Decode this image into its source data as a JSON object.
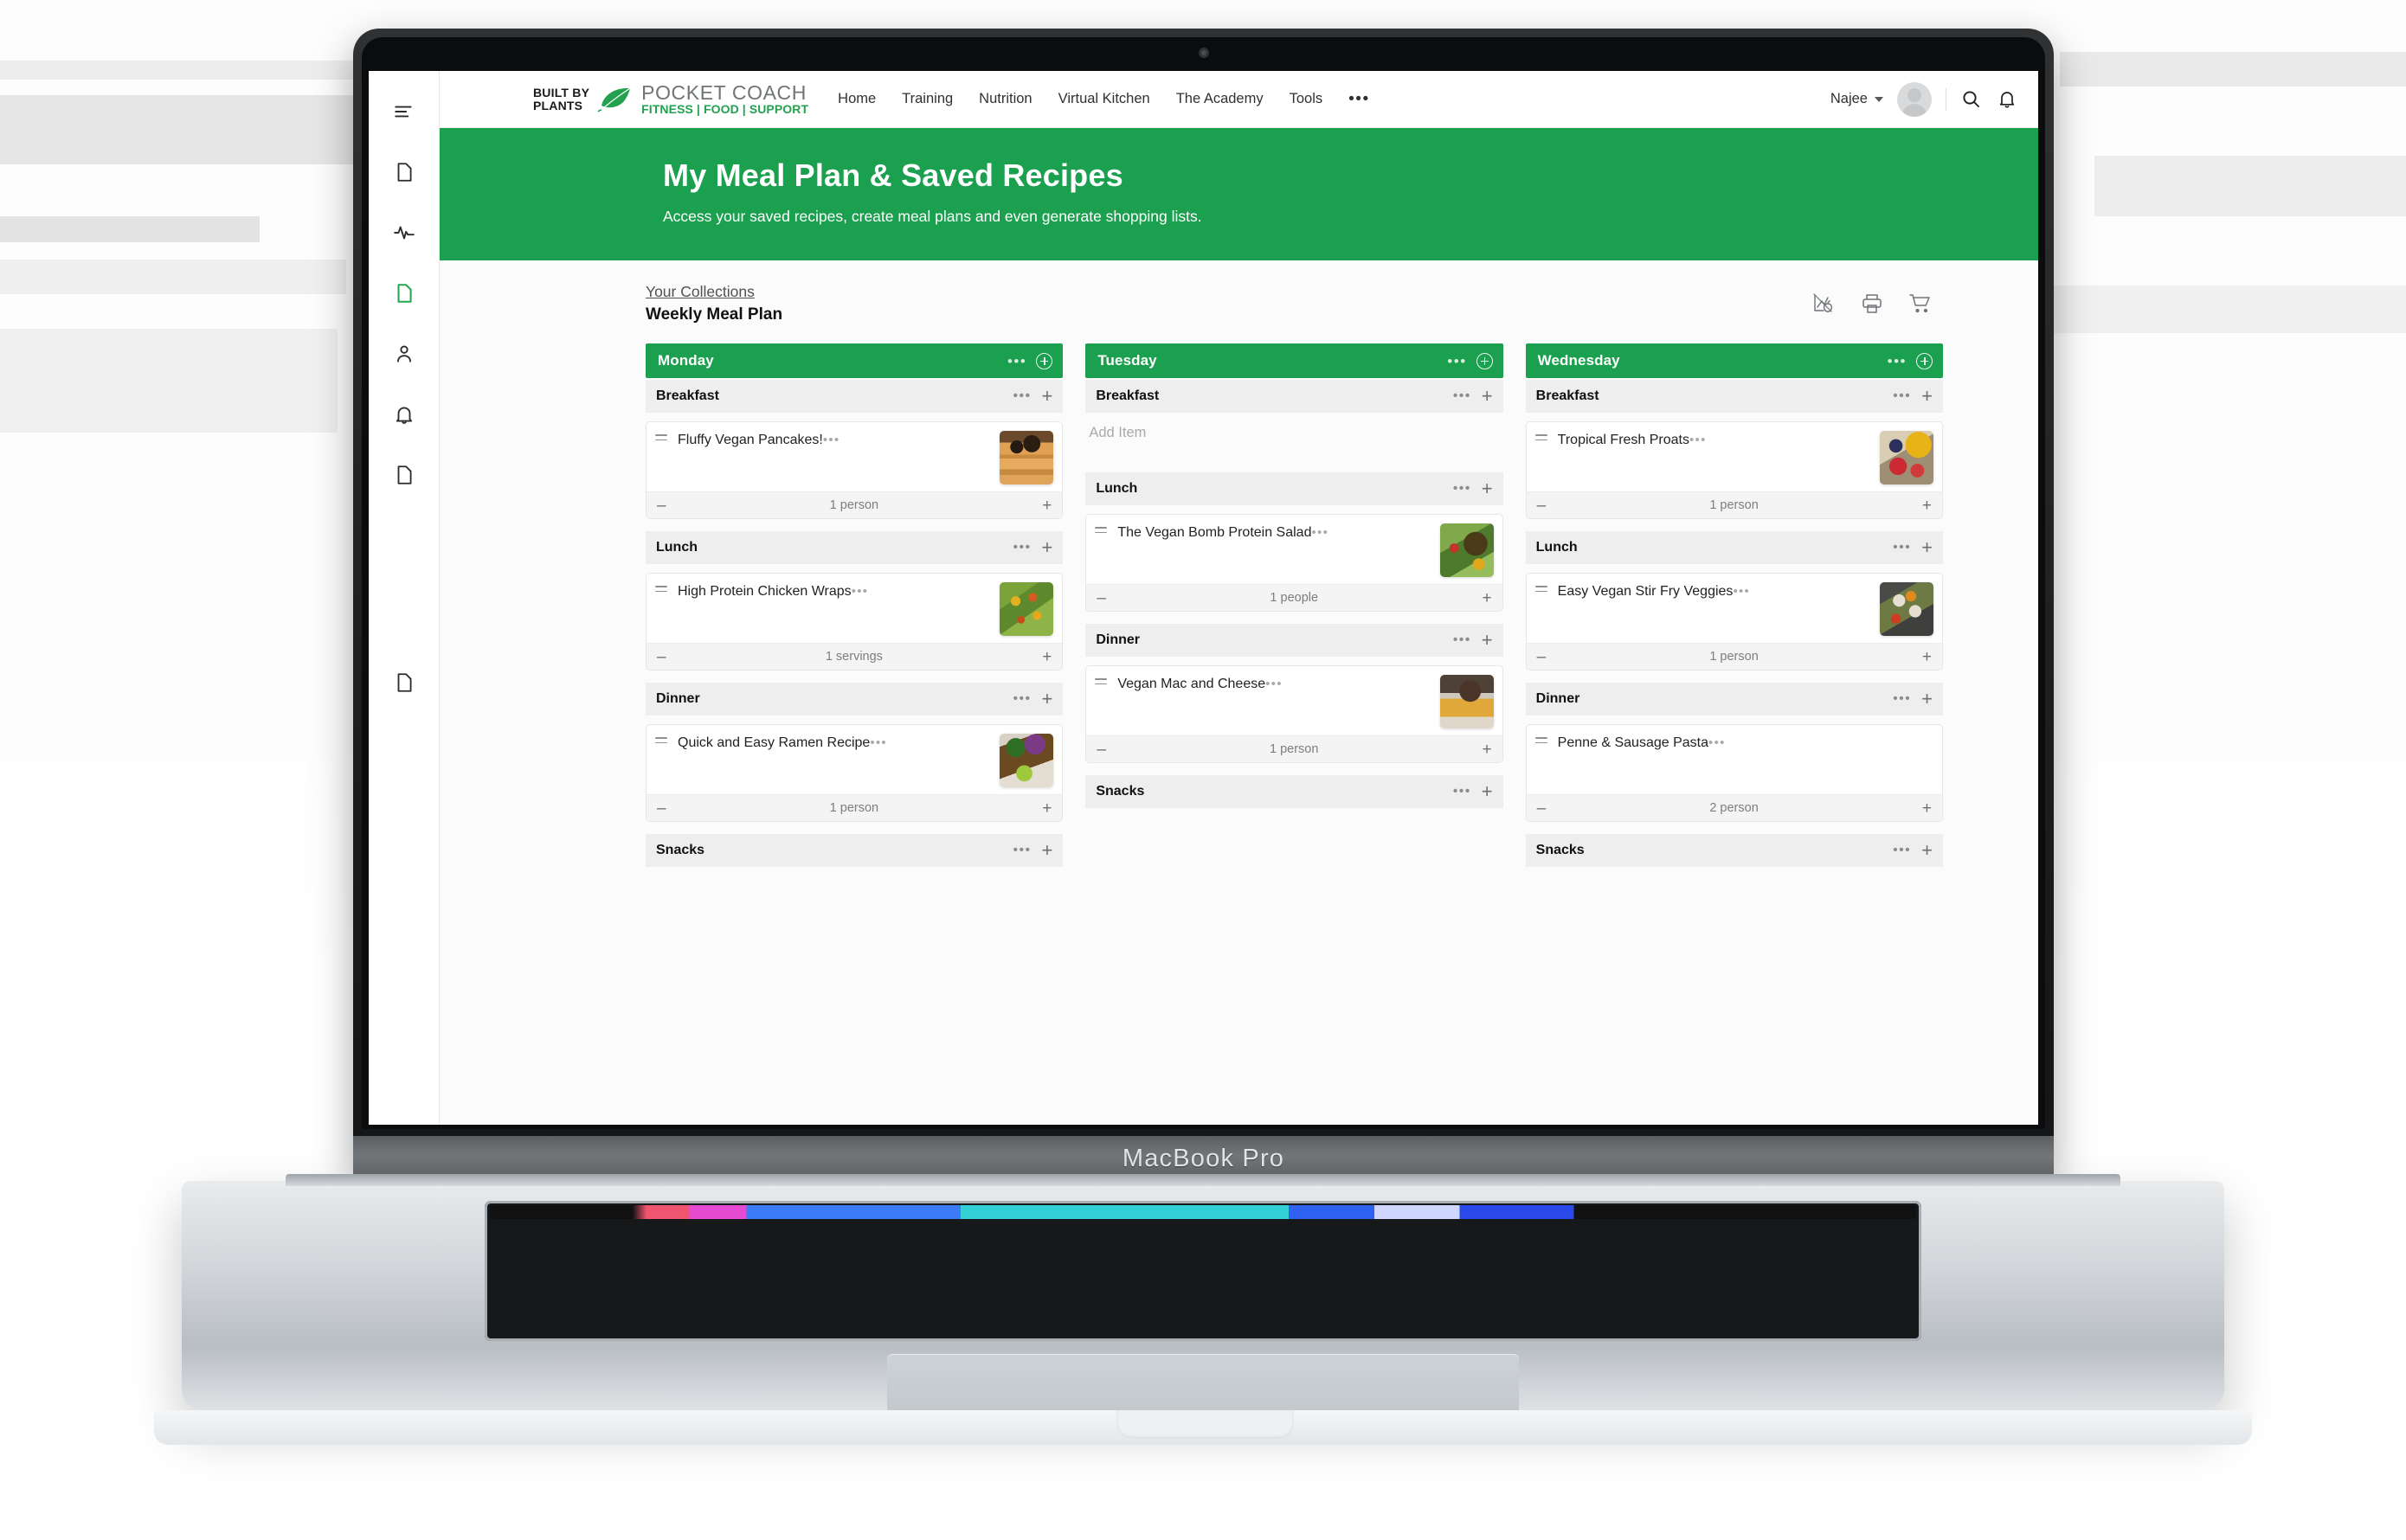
{
  "device": {
    "model_label": "MacBook Pro"
  },
  "brand": {
    "built_by": "BUILT BY",
    "plants": "PLANTS",
    "title": "POCKET COACH",
    "subtitle": "FITNESS | FOOD | SUPPORT",
    "accent_green": "#1aa04e"
  },
  "nav": {
    "items": [
      {
        "label": "Home"
      },
      {
        "label": "Training"
      },
      {
        "label": "Nutrition"
      },
      {
        "label": "Virtual Kitchen"
      },
      {
        "label": "The Academy"
      },
      {
        "label": "Tools"
      }
    ],
    "overflow": "•••"
  },
  "account": {
    "name": "Najee"
  },
  "hero": {
    "title": "My Meal Plan & Saved Recipes",
    "subtitle": "Access your saved recipes, create meal plans and even generate shopping lists."
  },
  "board": {
    "collections_link": "Your Collections",
    "plan_title": "Weekly Meal Plan",
    "empty_placeholder": "Add Item",
    "section_dots": "•••",
    "section_plus": "+",
    "card_dots": "•••",
    "minus": "–",
    "plus": "+"
  },
  "sidebar": {
    "items": [
      {
        "name": "menu-icon"
      },
      {
        "name": "document-icon"
      },
      {
        "name": "activity-icon"
      },
      {
        "name": "document-active-icon"
      },
      {
        "name": "person-icon"
      },
      {
        "name": "bell-icon"
      },
      {
        "name": "document-icon"
      }
    ],
    "bottom": {
      "name": "document-icon"
    }
  },
  "toolbar": {
    "nutrition_label": "nutrition-icon",
    "print_label": "print-icon",
    "cart_label": "cart-icon"
  },
  "days": [
    {
      "name": "Monday",
      "meals": [
        {
          "name": "Breakfast",
          "items": [
            {
              "title": "Fluffy Vegan Pancakes!",
              "qty": "1 person",
              "thumb": "t-pancake"
            }
          ]
        },
        {
          "name": "Lunch",
          "items": [
            {
              "title": "High Protein Chicken Wraps",
              "qty": "1 servings",
              "thumb": "t-wrap"
            }
          ]
        },
        {
          "name": "Dinner",
          "items": [
            {
              "title": "Quick and Easy Ramen Recipe",
              "qty": "1 person",
              "thumb": "t-ramen"
            }
          ]
        },
        {
          "name": "Snacks",
          "items": []
        }
      ]
    },
    {
      "name": "Tuesday",
      "meals": [
        {
          "name": "Breakfast",
          "items": []
        },
        {
          "name": "Lunch",
          "items": [
            {
              "title": "The Vegan Bomb Protein Salad",
              "qty": "1 people",
              "thumb": "t-salad"
            }
          ]
        },
        {
          "name": "Dinner",
          "items": [
            {
              "title": "Vegan Mac and Cheese",
              "qty": "1 person",
              "thumb": "t-mac"
            }
          ]
        },
        {
          "name": "Snacks",
          "items": []
        }
      ]
    },
    {
      "name": "Wednesday",
      "meals": [
        {
          "name": "Breakfast",
          "items": [
            {
              "title": "Tropical Fresh Proats",
              "qty": "1 person",
              "thumb": "t-proats"
            }
          ]
        },
        {
          "name": "Lunch",
          "items": [
            {
              "title": "Easy Vegan Stir Fry Veggies",
              "qty": "1 person",
              "thumb": "t-stirfry"
            }
          ]
        },
        {
          "name": "Dinner",
          "items": [
            {
              "title": "Penne & Sausage Pasta",
              "qty": "2 person",
              "thumb": ""
            }
          ]
        },
        {
          "name": "Snacks",
          "items": []
        }
      ]
    }
  ]
}
